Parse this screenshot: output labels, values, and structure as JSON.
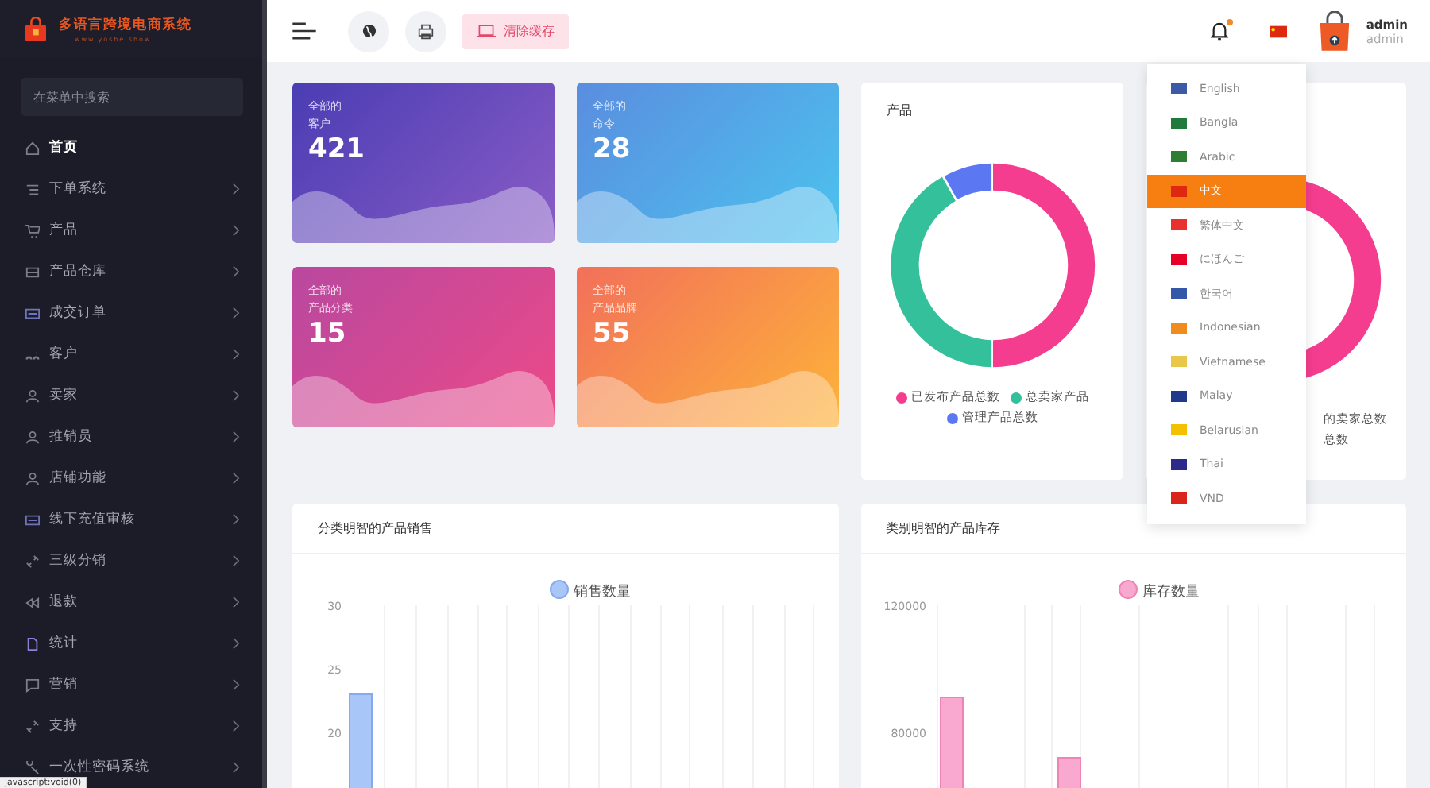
{
  "sidebar": {
    "title": "多语言跨境电商系统",
    "subtitle": "www.yoshe.show",
    "search": {
      "placeholder": "在菜单中搜索"
    },
    "items": [
      {
        "label": "首页",
        "selected": true,
        "submenu": false
      },
      {
        "label": "下单系统",
        "selected": false,
        "submenu": true
      },
      {
        "label": "产品",
        "selected": false,
        "submenu": true
      },
      {
        "label": "产品仓库",
        "selected": false,
        "submenu": true
      },
      {
        "label": "成交订单",
        "selected": false,
        "submenu": true
      },
      {
        "label": "客户",
        "selected": false,
        "submenu": true
      },
      {
        "label": "卖家",
        "selected": false,
        "submenu": true
      },
      {
        "label": "推销员",
        "selected": false,
        "submenu": true
      },
      {
        "label": "店铺功能",
        "selected": false,
        "submenu": true
      },
      {
        "label": "线下充值审核",
        "selected": false,
        "submenu": true
      },
      {
        "label": "三级分销",
        "selected": false,
        "submenu": true
      },
      {
        "label": "退款",
        "selected": false,
        "submenu": true
      },
      {
        "label": "统计",
        "selected": false,
        "submenu": true
      },
      {
        "label": "营销",
        "selected": false,
        "submenu": true
      },
      {
        "label": "支持",
        "selected": false,
        "submenu": true
      },
      {
        "label": "一次性密码系统",
        "selected": false,
        "submenu": true
      }
    ]
  },
  "status_link": "javascript:void(0)",
  "header": {
    "clear_cache_button": "清除缓存",
    "notification_dot": true,
    "user": {
      "name": "admin",
      "role": "admin"
    }
  },
  "language_menu": [
    {
      "label": "English",
      "color": "#3c5aa6",
      "selected": false
    },
    {
      "label": "Bangla",
      "color": "#1f7a3c",
      "selected": false
    },
    {
      "label": "Arabic",
      "color": "#2e7d32",
      "selected": false
    },
    {
      "label": "中文",
      "color": "#de2910",
      "selected": true
    },
    {
      "label": "繁体中文",
      "color": "#e8312f",
      "selected": false
    },
    {
      "label": "にほんご",
      "color": "#e60026",
      "selected": false
    },
    {
      "label": "한국어",
      "color": "#3457a8",
      "selected": false
    },
    {
      "label": "Indonesian",
      "color": "#f08c1e",
      "selected": false
    },
    {
      "label": "Vietnamese",
      "color": "#e8c84a",
      "selected": false
    },
    {
      "label": "Malay",
      "color": "#1f3a8a",
      "selected": false
    },
    {
      "label": "Belarusian",
      "color": "#f2c200",
      "selected": false
    },
    {
      "label": "Thai",
      "color": "#2d2a8a",
      "selected": false
    },
    {
      "label": "VND",
      "color": "#da251d",
      "selected": false
    }
  ],
  "stat_cards": [
    {
      "caption": "全部的",
      "label": "客户",
      "value": "421"
    },
    {
      "caption": "全部的",
      "label": "命令",
      "value": "28"
    },
    {
      "caption": "全部的",
      "label": "产品分类",
      "value": "15"
    },
    {
      "caption": "全部的",
      "label": "产品品牌",
      "value": "55"
    }
  ],
  "product_card": {
    "title": "产品",
    "legend": [
      {
        "label": "已发布产品总数",
        "color": "#f53d8f"
      },
      {
        "label": "总卖家产品",
        "color": "#33c09a"
      },
      {
        "label": "管理产品总数",
        "color": "#5b78f2"
      }
    ]
  },
  "seller_card": {
    "legend": [
      "的卖家总数",
      "总数"
    ]
  },
  "sales_chart": {
    "title": "分类明智的产品销售",
    "chart_data": {
      "type": "bar",
      "categories": [
        null
      ],
      "series": [
        {
          "name": "销售数量",
          "color": "#a9c6f8",
          "values": [
            23
          ]
        }
      ],
      "ylim": [
        0,
        30
      ],
      "yticks": [
        20,
        25,
        30
      ]
    }
  },
  "stock_chart": {
    "title": "类别明智的产品库存",
    "chart_data": {
      "type": "bar",
      "categories": [
        null,
        null
      ],
      "series": [
        {
          "name": "库存数量",
          "color": "#f9a8cf",
          "values": [
            91000,
            72000
          ]
        }
      ],
      "ylim": [
        0,
        120000
      ],
      "yticks": [
        80000,
        120000
      ]
    }
  }
}
